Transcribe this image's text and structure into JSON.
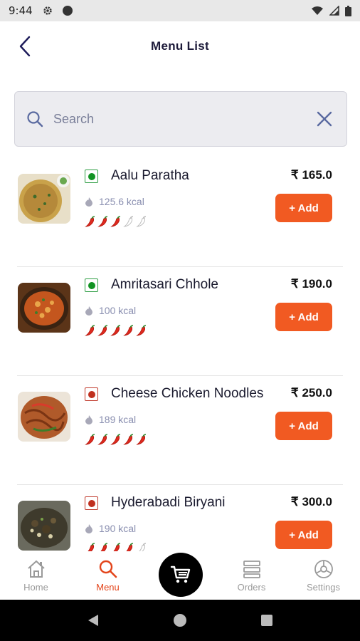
{
  "status_bar": {
    "time": "9:44"
  },
  "header": {
    "title": "Menu List"
  },
  "search": {
    "placeholder": "Search"
  },
  "items": [
    {
      "name": "Aalu Paratha",
      "price": "₹ 165.0",
      "kcal": "125.6 kcal",
      "type": "veg",
      "spice_level": 3,
      "spice_max": 5,
      "add_label": "+ Add",
      "image": "aalu-paratha-photo"
    },
    {
      "name": "Amritasari Chhole",
      "price": "₹ 190.0",
      "kcal": "100 kcal",
      "type": "veg",
      "spice_level": 5,
      "spice_max": 5,
      "add_label": "+ Add",
      "image": "amritsari-chhole-photo"
    },
    {
      "name": "Cheese Chicken Noodles",
      "price": "₹ 250.0",
      "kcal": "189 kcal",
      "type": "nonveg",
      "spice_level": 5,
      "spice_max": 5,
      "add_label": "+ Add",
      "image": "cheese-chicken-noodles-photo"
    },
    {
      "name": "Hyderabadi Biryani",
      "price": "₹ 300.0",
      "kcal": "190 kcal",
      "type": "nonveg",
      "spice_level": 4,
      "spice_max": 5,
      "add_label": "+ Add",
      "image": "hyderabadi-biryani-photo"
    }
  ],
  "bottom_nav": {
    "home": "Home",
    "menu": "Menu",
    "orders": "Orders",
    "settings": "Settings",
    "active": "menu"
  },
  "colors": {
    "accent": "#f15a22",
    "active_nav": "#e3441a",
    "veg": "#109322",
    "nonveg": "#c0301f",
    "title": "#1d1b3a"
  }
}
